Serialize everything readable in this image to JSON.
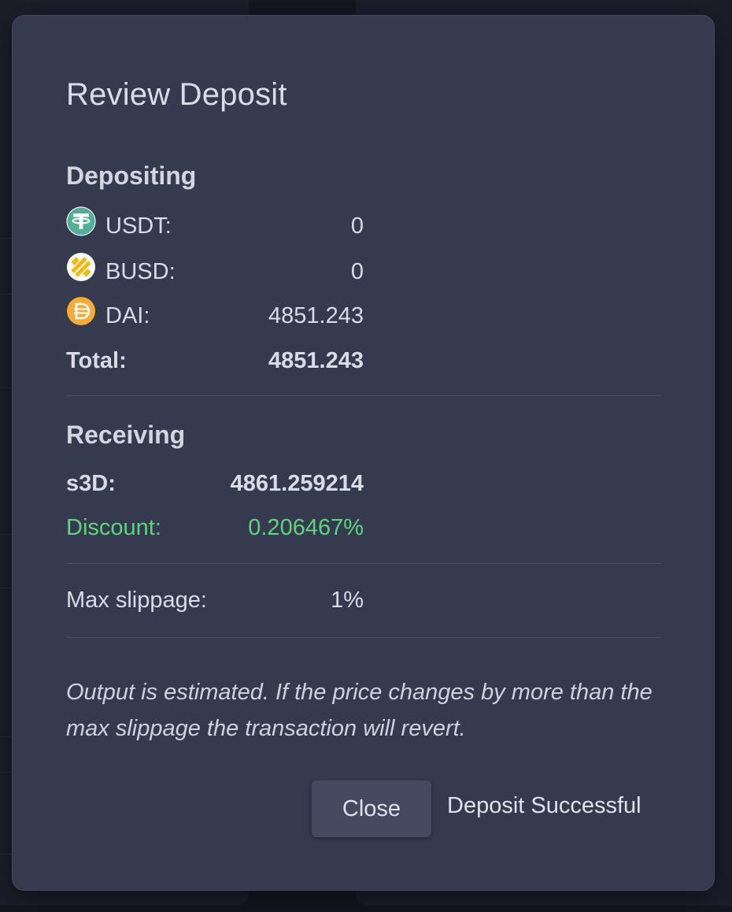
{
  "modal": {
    "title": "Review Deposit",
    "depositing": {
      "heading": "Depositing",
      "tokens": [
        {
          "symbol": "USDT:",
          "amount": "0",
          "icon": "usdt-icon",
          "color": "#50af95"
        },
        {
          "symbol": "BUSD:",
          "amount": "0",
          "icon": "busd-icon",
          "color": "#f0b90b"
        },
        {
          "symbol": "DAI:",
          "amount": "4851.243",
          "icon": "dai-icon",
          "color": "#f5ac37"
        }
      ],
      "total_label": "Total:",
      "total_value": "4851.243"
    },
    "receiving": {
      "heading": "Receiving",
      "token_label": "s3D:",
      "token_value": "4861.259214",
      "discount_label": "Discount:",
      "discount_value": "0.206467%",
      "discount_color": "#5ed47d"
    },
    "slippage": {
      "label": "Max slippage:",
      "value": "1%"
    },
    "note": "Output is estimated. If the price changes by more than the max slippage the transaction will revert.",
    "close_label": "Close",
    "status_text": "Deposit Successful"
  },
  "colors": {
    "modal_background": "#353a4f",
    "page_background": "#15171f",
    "text": "#d9dce6"
  }
}
